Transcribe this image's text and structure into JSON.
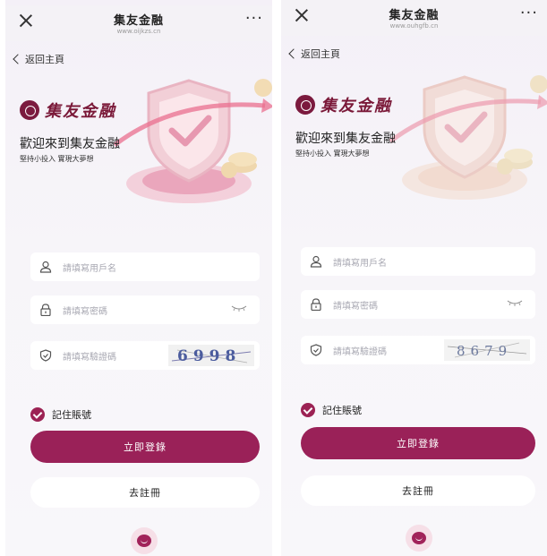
{
  "panels": [
    {
      "titlebar": {
        "title": "集友金融",
        "url": "www.oijkzs.cn",
        "menu": "···"
      },
      "back_label": "返回主頁",
      "brand": "集友金融",
      "welcome": "歡迎來到集友金融",
      "slogan": "堅持小投入 實現大夢想",
      "username_placeholder": "請填寫用戶名",
      "password_placeholder": "請填寫密碼",
      "captcha_placeholder": "請填寫驗證碼",
      "captcha_text": "6998",
      "remember_label": "記住賬號",
      "login_label": "立即登錄",
      "register_label": "去註冊"
    },
    {
      "titlebar": {
        "title": "集友金融",
        "url": "www.ouhgfb.cn",
        "menu": "···"
      },
      "back_label": "返回主頁",
      "brand": "集友金融",
      "welcome": "歡迎來到集友金融",
      "slogan": "堅持小投入 實現大夢想",
      "username_placeholder": "請填寫用戶名",
      "password_placeholder": "請填寫密碼",
      "captcha_placeholder": "請填寫驗證碼",
      "captcha_text": "8679",
      "remember_label": "記住賬號",
      "login_label": "立即登錄",
      "register_label": "去註冊"
    }
  ],
  "icons": [
    "close-icon",
    "more-icon",
    "back-chevron-icon",
    "user-icon",
    "lock-icon",
    "eye-closed-icon",
    "shield-check-icon",
    "checkbox-checked-icon",
    "chat-icon"
  ],
  "colors": {
    "brand": "#7a1838",
    "button": "#9a2158",
    "checkbox": "#9c2254",
    "placeholder": "#a9a9b3"
  }
}
